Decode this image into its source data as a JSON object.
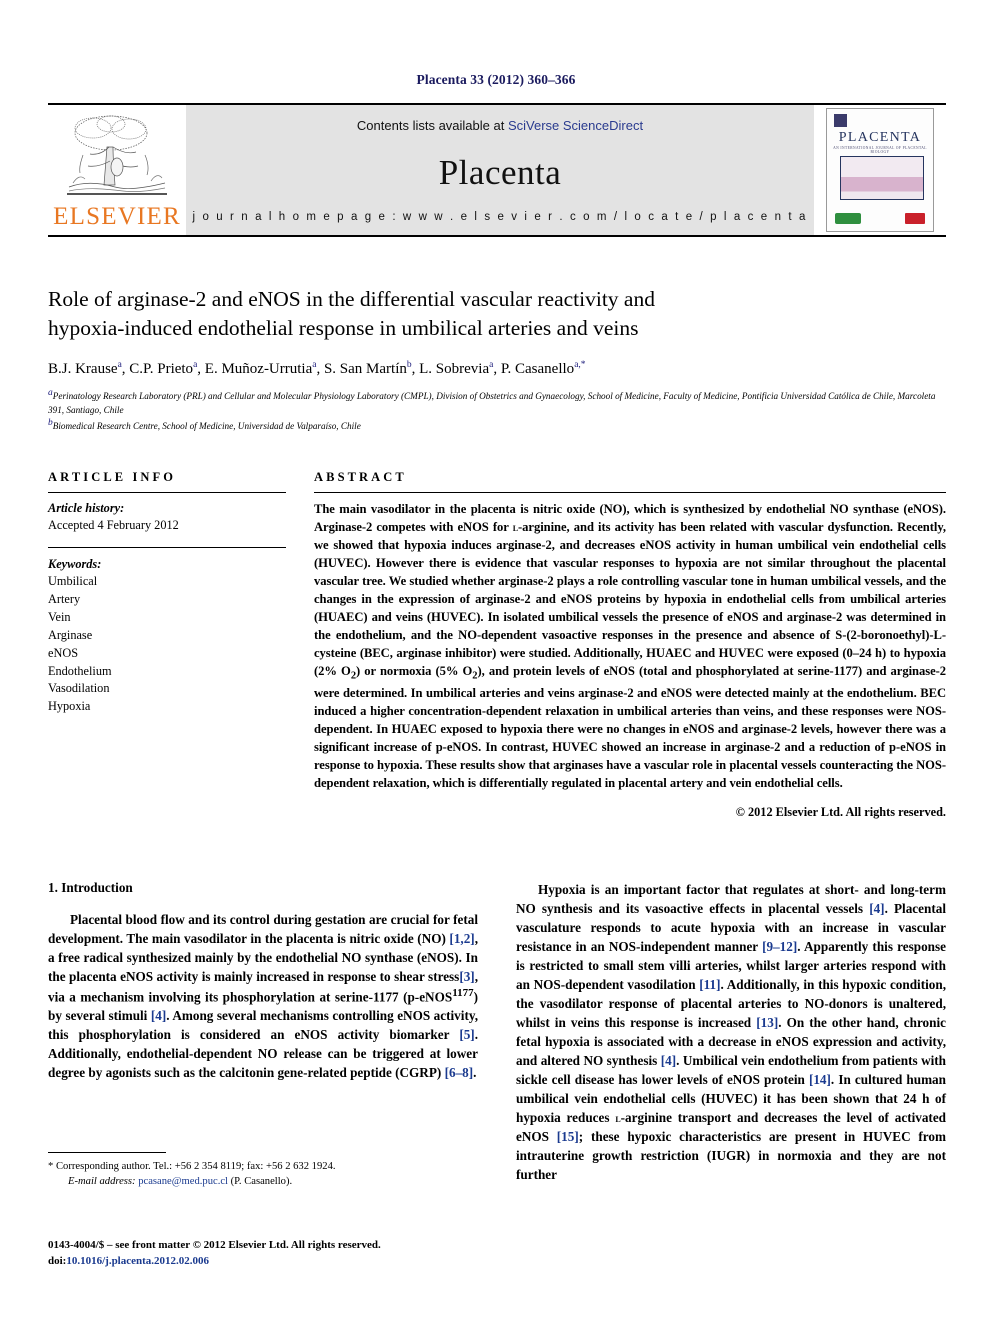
{
  "running_head": "Placenta 33 (2012) 360–366",
  "banner": {
    "publisher_name": "ELSEVIER",
    "contents_prefix": "Contents lists available at ",
    "contents_link": "SciVerse ScienceDirect",
    "journal_name": "Placenta",
    "homepage": "j o u r n a l   h o m e p a g e :   w w w . e l s e v i e r . c o m / l o c a t e / p l a c e n t a",
    "cover": {
      "title": "PLACENTA",
      "subtitle": "AN INTERNATIONAL JOURNAL OF PLACENTAL BIOLOGY"
    }
  },
  "article": {
    "title_line1": "Role of arginase-2 and eNOS in the differential vascular reactivity and",
    "title_line2": "hypoxia-induced endothelial response in umbilical arteries and veins",
    "authors": [
      {
        "name": "B.J. Krause",
        "mark": "a",
        "sep": ", "
      },
      {
        "name": "C.P. Prieto",
        "mark": "a",
        "sep": ", "
      },
      {
        "name": "E. Muñoz-Urrutia",
        "mark": "a",
        "sep": ", "
      },
      {
        "name": "S. San Martín",
        "mark": "b",
        "sep": ", "
      },
      {
        "name": "L. Sobrevia",
        "mark": "a",
        "sep": ", "
      },
      {
        "name": "P. Casanello",
        "mark": "a,*",
        "sep": ""
      }
    ],
    "affiliation_a_mark": "a",
    "affiliation_a": "Perinatology Research Laboratory (PRL) and Cellular and Molecular Physiology Laboratory (CMPL), Division of Obstetrics and Gynaecology, School of Medicine, Faculty of Medicine, Pontificia Universidad Católica de Chile, Marcoleta 391, Santiago, Chile",
    "affiliation_b_mark": "b",
    "affiliation_b": "Biomedical Research Centre, School of Medicine, Universidad de Valparaíso, Chile"
  },
  "article_info": {
    "heading": "ARTICLE INFO",
    "history_label": "Article history:",
    "history_value": "Accepted 4 February 2012",
    "keywords_label": "Keywords:",
    "keywords": [
      "Umbilical",
      "Artery",
      "Vein",
      "Arginase",
      "eNOS",
      "Endothelium",
      "Vasodilation",
      "Hypoxia"
    ]
  },
  "abstract": {
    "heading": "ABSTRACT",
    "text_part1": "The main vasodilator in the placenta is nitric oxide (NO), which is synthesized by endothelial NO synthase (eNOS). Arginase-2 competes with eNOS for ",
    "small_caps_1": "l",
    "text_part2": "-arginine, and its activity has been related with vascular dysfunction. Recently, we showed that hypoxia induces arginase-2, and decreases eNOS activity in human umbilical vein endothelial cells (HUVEC). However there is evidence that vascular responses to hypoxia are not similar throughout the placental vascular tree. We studied whether arginase-2 plays a role controlling vascular tone in human umbilical vessels, and the changes in the expression of arginase-2 and eNOS proteins by hypoxia in endothelial cells from umbilical arteries (HUAEC) and veins (HUVEC). In isolated umbilical vessels the presence of eNOS and arginase-2 was determined in the endothelium, and the NO-dependent vasoactive responses in the presence and absence of S-(2-boronoethyl)-L-cysteine (BEC, arginase inhibitor) were studied. Additionally, HUAEC and HUVEC were exposed (0–24 h) to hypoxia (2% O",
    "sub_1": "2",
    "text_part3": ") or normoxia (5% O",
    "sub_2": "2",
    "text_part4": "), and protein levels of eNOS (total and phosphorylated at serine-1177) and arginase-2 were determined. In umbilical arteries and veins arginase-2 and eNOS were detected mainly at the endothelium. BEC induced a higher concentration-dependent relaxation in umbilical arteries than veins, and these responses were NOS-dependent. In HUAEC exposed to hypoxia there were no changes in eNOS and arginase-2 levels, however there was a significant increase of p-eNOS. In contrast, HUVEC showed an increase in arginase-2 and a reduction of p-eNOS in response to hypoxia. These results show that arginases have a vascular role in placental vessels counteracting the NOS-dependent relaxation, which is differentially regulated in placental artery and vein endothelial cells.",
    "copyright": "© 2012 Elsevier Ltd. All rights reserved."
  },
  "introduction": {
    "section_number_title": "1. Introduction",
    "left_para_a_1": "Placental blood flow and its control during gestation are crucial for fetal development. The main vasodilator in the placenta is nitric oxide (NO) ",
    "left_ref_1": "[1,2]",
    "left_para_a_2": ", a free radical synthesized mainly by the endothelial NO synthase (eNOS). In the placenta eNOS activity is mainly increased in response to shear stress",
    "left_ref_2": "[3]",
    "left_para_a_3": ", via a mechanism involving its phosphorylation at serine-1177 (p-eNOS",
    "left_sup_1": "1177",
    "left_para_a_4": ") by several stimuli ",
    "left_ref_3": "[4]",
    "left_para_a_5": ". Among several mechanisms controlling eNOS activity, this phosphorylation is considered an eNOS activity biomarker ",
    "left_ref_4": "[5]",
    "left_para_a_6": ". Additionally, endothelial-dependent NO release can be triggered at lower degree by agonists such as the calcitonin gene-related peptide (CGRP) ",
    "left_ref_5": "[6–8]",
    "left_para_a_7": ".",
    "right_para_1": "Hypoxia is an important factor that regulates at short- and long-term NO synthesis and its vasoactive effects in placental vessels ",
    "right_ref_1": "[4]",
    "right_para_2": ". Placental vasculature responds to acute hypoxia with an increase in vascular resistance in an NOS-independent manner ",
    "right_ref_2": "[9–12]",
    "right_para_3": ". Apparently this response is restricted to small stem villi arteries, whilst larger arteries respond with an NOS-dependent vasodilation ",
    "right_ref_3": "[11]",
    "right_para_4": ". Additionally, in this hypoxic condition, the vasodilator response of placental arteries to NO-donors is unaltered, whilst in veins this response is increased ",
    "right_ref_4": "[13]",
    "right_para_5": ". On the other hand, chronic fetal hypoxia is associated with a decrease in eNOS expression and activity, and altered NO synthesis ",
    "right_ref_5": "[4]",
    "right_para_6": ". Umbilical vein endothelium from patients with sickle cell disease has lower levels of eNOS protein ",
    "right_ref_6": "[14]",
    "right_para_7": ". In cultured human umbilical vein endothelial cells (HUVEC) it has been shown that 24 h of hypoxia reduces ",
    "right_smallcaps": "l",
    "right_para_8": "-arginine transport and decreases the level of activated eNOS ",
    "right_ref_7": "[15]",
    "right_para_9": "; these hypoxic characteristics are present in HUVEC from intrauterine growth restriction (IUGR) in normoxia and they are not further"
  },
  "footnotes": {
    "corresponding_marker": "*",
    "corresponding_text": "Corresponding author. Tel.: +56 2 354 8119; fax: +56 2 632 1924.",
    "email_label": "E-mail address:",
    "email": "pcasane@med.puc.cl",
    "email_owner": "(P. Casanello)."
  },
  "footer": {
    "issn_line": "0143-4004/$ – see front matter © 2012 Elsevier Ltd. All rights reserved.",
    "doi_prefix": "doi:",
    "doi": "10.1016/j.placenta.2012.02.006"
  },
  "colors": {
    "link_blue": "#1a3a8f",
    "elsevier_orange": "#E87722",
    "banner_grey": "#e3e3e3",
    "running_head_navy": "#1a1a5e"
  }
}
